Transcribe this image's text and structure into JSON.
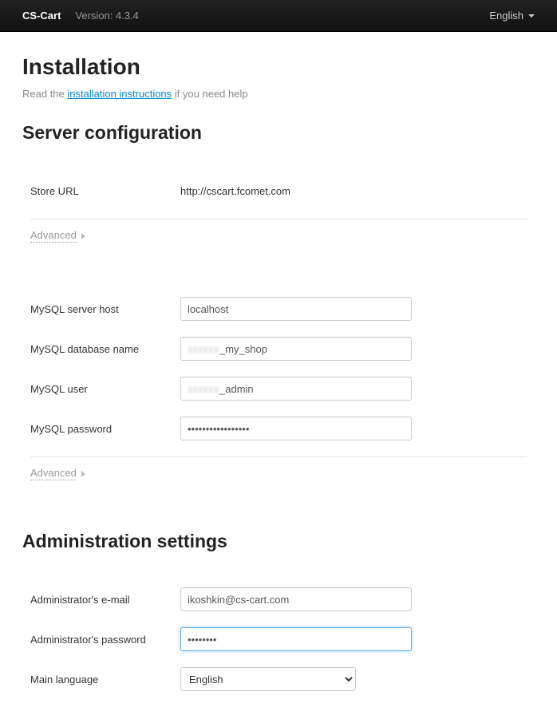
{
  "topbar": {
    "brand": "CS-Cart",
    "version": "Version: 4.3.4",
    "language": "English"
  },
  "header": {
    "title": "Installation",
    "subline_prefix": "Read the ",
    "subline_link": "installation instructions",
    "subline_suffix": " if you need help"
  },
  "sections": {
    "server": {
      "title": "Server configuration",
      "store_url_label": "Store URL",
      "store_url_value": "http://cscart.fcomet.com",
      "advanced": "Advanced",
      "mysql_host_label": "MySQL server host",
      "mysql_host_value": "localhost",
      "mysql_db_label": "MySQL database name",
      "mysql_db_value": "_my_shop",
      "mysql_db_prefix_hidden": "xxxxxx",
      "mysql_user_label": "MySQL user",
      "mysql_user_value": "_admin",
      "mysql_user_prefix_hidden": "xxxxxx",
      "mysql_pass_label": "MySQL password",
      "mysql_pass_value": "•••••••••••••••••",
      "advanced2": "Advanced"
    },
    "admin": {
      "title": "Administration settings",
      "email_label": "Administrator's e-mail",
      "email_value": "ikoshkin@cs-cart.com",
      "pass_label": "Administrator's password",
      "pass_value": "••••••••",
      "lang_label": "Main language",
      "lang_value": "English",
      "lang_options": [
        "English"
      ]
    }
  }
}
